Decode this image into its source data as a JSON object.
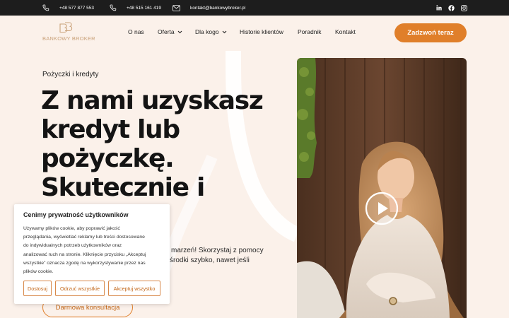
{
  "topbar": {
    "phone1": "+48 577 877 553",
    "phone2": "+48 515 161 419",
    "email": "kontakt@bankowybroker.pl",
    "social": [
      "linkedin-icon",
      "facebook-icon",
      "instagram-icon"
    ]
  },
  "header": {
    "logo_text": "BANKOWY BROKER",
    "nav": [
      {
        "label": "O nas",
        "dropdown": false
      },
      {
        "label": "Oferta",
        "dropdown": true
      },
      {
        "label": "Dla kogo",
        "dropdown": true
      },
      {
        "label": "Historie klientów",
        "dropdown": false
      },
      {
        "label": "Poradnik",
        "dropdown": false
      },
      {
        "label": "Kontakt",
        "dropdown": false
      }
    ],
    "cta_label": "Zadzwoń teraz"
  },
  "hero": {
    "eyebrow": "Pożyczki i kredyty",
    "headline_lines": [
      "Z nami uzyskasz",
      "kredyt lub",
      "pożyczkę.",
      "Skutecznie i"
    ],
    "lead_lines": [
      "marzeń! Skorzystaj z pomocy",
      "środki szybko, nawet jeśli"
    ],
    "consult_label": "Darmowa konsultacja"
  },
  "cookie": {
    "title": "Cenimy prywatność użytkowników",
    "body_lines": [
      "Używamy plików cookie, aby poprawić jakość",
      "przeglądania, wyświetlać reklamy lub treści dostosowane",
      "do indywidualnych potrzeb użytkowników oraz",
      "analizować ruch na stronie. Kliknięcie przycisku „Akceptuj",
      "wszystkie” oznacza zgodę na wykorzystywanie przez nas",
      "plików cookie."
    ],
    "buttons": [
      "Dostosuj",
      "Odrzuć wszystkie",
      "Akceptuj wszystko"
    ]
  },
  "colors": {
    "accent": "#e07f2a",
    "background": "#fbf1ea",
    "topbar": "#1d1d1d",
    "logo": "#caa27a"
  }
}
